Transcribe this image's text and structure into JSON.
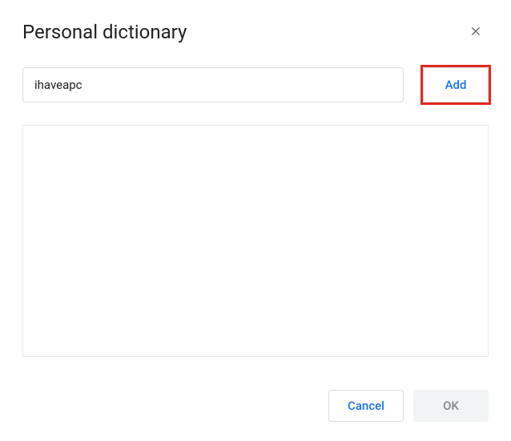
{
  "dialog": {
    "title": "Personal dictionary"
  },
  "input": {
    "value": "ihaveapc",
    "placeholder": ""
  },
  "buttons": {
    "add": "Add",
    "cancel": "Cancel",
    "ok": "OK"
  },
  "wordList": {
    "items": []
  }
}
